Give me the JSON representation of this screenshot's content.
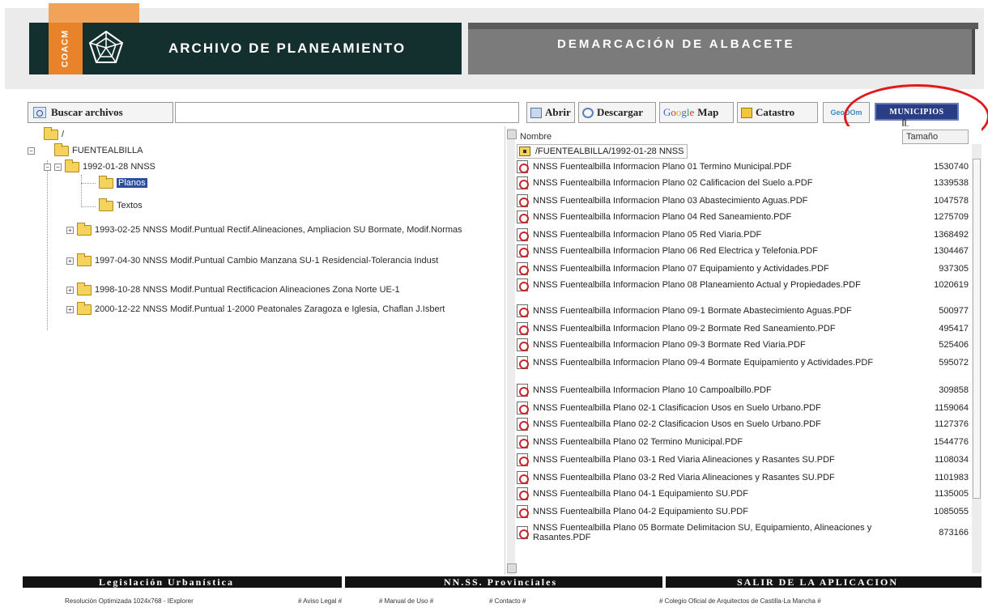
{
  "header": {
    "logo_text": "COACM",
    "title": "ARCHIVO DE PLANEAMIENTO",
    "region": "DEMARCACIÓN DE ALBACETE"
  },
  "toolbar": {
    "search_label": "Buscar archivos",
    "search_value": "",
    "open_label": "Abrir",
    "download_label": "Descargar",
    "google_g1": "G",
    "google_g2": "o",
    "google_g3": "o",
    "google_g4": "g",
    "google_g5": "l",
    "google_g6": "e",
    "map_label": "Map",
    "catastro_label": "Catastro",
    "geo_label": "GeoDOm",
    "municipios_label": "MUNICIPIOS"
  },
  "tree": {
    "root": "/",
    "municipality": "FUENTEALBILLA",
    "nodes": [
      "1992-01-28 NNSS",
      "Planos",
      "Textos",
      "1993-02-25 NNSS Modif.Puntual Rectif.Alineaciones, Ampliacion SU Bormate, Modif.Normas",
      "1997-04-30 NNSS Modif.Puntual Cambio Manzana SU-1 Residencial-Tolerancia Indust",
      "1998-10-28 NNSS Modif.Puntual Rectificacion Alineaciones Zona Norte UE-1",
      "2000-12-22 NNSS Modif.Puntual 1-2000 Peatonales Zaragoza e Iglesia, Chaflan J.Isbert"
    ]
  },
  "files": {
    "col_name": "Nombre",
    "col_size": "Tamaño",
    "current_path": "/FUENTEALBILLA/1992-01-28 NNSS",
    "rows": [
      {
        "name": "NNSS Fuentealbilla Informacion Plano 01 Termino Municipal.PDF",
        "size": "1530740"
      },
      {
        "name": "NNSS Fuentealbilla Informacion Plano 02 Calificacion del Suelo a.PDF",
        "size": "1339538"
      },
      {
        "name": "NNSS Fuentealbilla Informacion Plano 03 Abastecimiento Aguas.PDF",
        "size": "1047578"
      },
      {
        "name": "NNSS Fuentealbilla Informacion Plano 04 Red Saneamiento.PDF",
        "size": "1275709"
      },
      {
        "name": "NNSS Fuentealbilla Informacion Plano 05 Red Viaria.PDF",
        "size": "1368492"
      },
      {
        "name": "NNSS Fuentealbilla Informacion Plano 06 Red Electrica y Telefonia.PDF",
        "size": "1304467"
      },
      {
        "name": "NNSS Fuentealbilla Informacion Plano 07 Equipamiento y Actividades.PDF",
        "size": "937305"
      },
      {
        "name": "NNSS Fuentealbilla Informacion Plano 08 Planeamiento Actual y Propiedades.PDF",
        "size": "1020619"
      },
      {
        "name": "NNSS Fuentealbilla Informacion Plano 09-1 Bormate Abastecimiento Aguas.PDF",
        "size": "500977"
      },
      {
        "name": "NNSS Fuentealbilla Informacion Plano 09-2 Bormate Red Saneamiento.PDF",
        "size": "495417"
      },
      {
        "name": "NNSS Fuentealbilla Informacion Plano 09-3 Bormate Red Viaria.PDF",
        "size": "525406"
      },
      {
        "name": "NNSS Fuentealbilla Informacion Plano 09-4 Bormate Equipamiento y Actividades.PDF",
        "size": "595072"
      },
      {
        "name": "NNSS Fuentealbilla Informacion Plano 10 Campoalbillo.PDF",
        "size": "309858"
      },
      {
        "name": "NNSS Fuentealbilla Plano 02-1 Clasificacion Usos en Suelo Urbano.PDF",
        "size": "1159064"
      },
      {
        "name": "NNSS Fuentealbilla Plano 02-2 Clasificacion Usos en Suelo Urbano.PDF",
        "size": "1127376"
      },
      {
        "name": "NNSS Fuentealbilla Plano 02 Termino Municipal.PDF",
        "size": "1544776"
      },
      {
        "name": "NNSS Fuentealbilla Plano 03-1 Red Viaria Alineaciones y Rasantes SU.PDF",
        "size": "1108034"
      },
      {
        "name": "NNSS Fuentealbilla Plano 03-2 Red Viaria Alineaciones y Rasantes SU.PDF",
        "size": "1101983"
      },
      {
        "name": "NNSS Fuentealbilla Plano 04-1 Equipamiento SU.PDF",
        "size": "1135005"
      },
      {
        "name": "NNSS Fuentealbilla Plano 04-2 Equipamiento SU.PDF",
        "size": "1085055"
      },
      {
        "name": "NNSS Fuentealbilla Plano 05 Bormate Delimitacion SU, Equipamiento, Alineaciones y Rasantes.PDF",
        "size": "873166"
      }
    ]
  },
  "footer": {
    "link1": "Legislación Urbanística",
    "link2": "NN.SS. Provinciales",
    "link3": "SALIR DE LA APLICACION",
    "resolution": "Resolución Optimizada 1024x768 - IExplorer",
    "aviso": "# Aviso Legal #",
    "manual": "# Manual de Uso #",
    "contacto": "# Contacto #",
    "colegio": "# Colegio Oficial de Arquitectos de Castilla-La Mancha #"
  },
  "colors": {
    "header_dark": "#14302e",
    "header_gray": "#7b7b7b",
    "accent_orange": "#e8832b",
    "municipios_blue": "#2a3e86",
    "highlight_red": "#e01a1a"
  }
}
